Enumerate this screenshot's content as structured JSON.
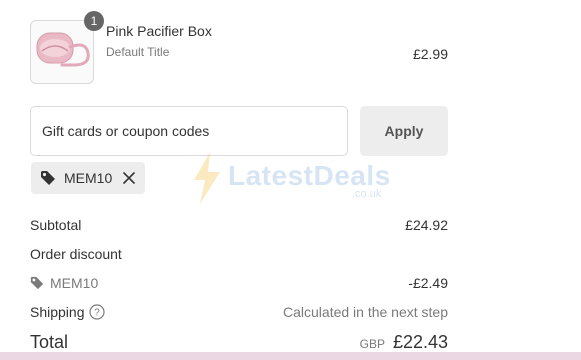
{
  "product": {
    "name": "Pink Pacifier Box",
    "variant": "Default Title",
    "price": "£2.99",
    "quantity": "1",
    "thumbnail_icon": "pacifier-box-icon"
  },
  "coupon": {
    "placeholder": "Gift cards or coupon codes",
    "apply_label": "Apply",
    "applied_code": "MEM10"
  },
  "watermark": {
    "name": "LatestDeals",
    "domain": ".co.uk"
  },
  "summary": {
    "subtotal_label": "Subtotal",
    "subtotal_value": "£24.92",
    "order_discount_label": "Order discount",
    "discount_code": "MEM10",
    "discount_value": "-£2.49",
    "shipping_label": "Shipping",
    "shipping_value": "Calculated in the next step",
    "total_label": "Total",
    "currency": "GBP",
    "total_value": "£22.43"
  },
  "colors": {
    "button_bg": "#ededed",
    "muted_text": "#7a7a7a",
    "badge_bg": "#666666",
    "product_pink": "#e8b4c0"
  }
}
